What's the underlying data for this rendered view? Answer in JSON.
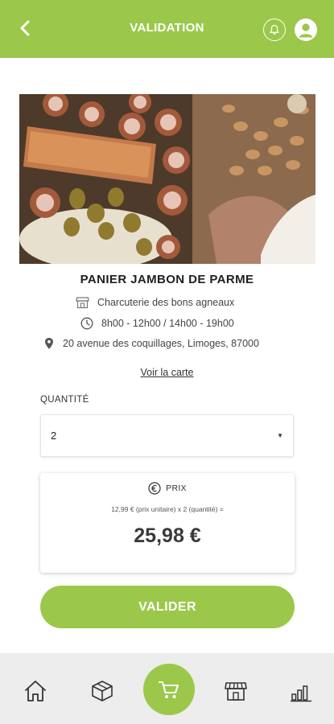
{
  "header": {
    "title": "VALIDATION",
    "back_icon": "chevron-left-icon",
    "bell_icon": "bell-icon",
    "user_icon": "user-icon"
  },
  "product": {
    "image_icon": "charcuterie-photo",
    "title": "PANIER JAMBON DE PARME",
    "shop": "Charcuterie des bons agneaux",
    "hours": "8h00 - 12h00 / 14h00 - 19h00",
    "address": "20 avenue des coquillages, Limoges, 87000",
    "map_link": "Voir la carte"
  },
  "quantity": {
    "label": "QUANTITÉ",
    "value": "2"
  },
  "price": {
    "label": "PRIX",
    "formula": "12,99 € (prix unitaire) x 2 (quantité) =",
    "total": "25,98 €"
  },
  "validate_label": "VALIDER",
  "nav": [
    "home-icon",
    "box-icon",
    "cart-icon",
    "shop-icon",
    "stats-icon"
  ],
  "colors": {
    "accent": "#9bc84b",
    "nav_bg": "#ededed"
  }
}
